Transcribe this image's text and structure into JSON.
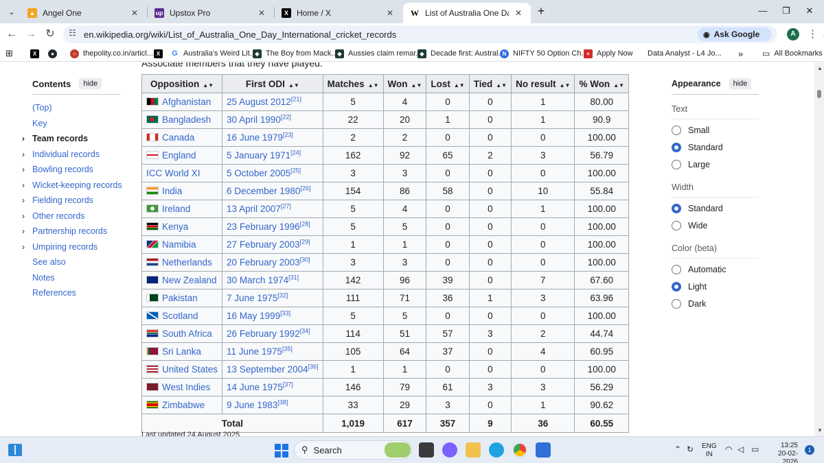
{
  "browser": {
    "tabs": [
      {
        "label": "Angel One",
        "icon": "angel-one-icon",
        "close": "✕"
      },
      {
        "label": "Upstox Pro",
        "icon": "upstox-icon",
        "close": "✕"
      },
      {
        "label": "Home / X",
        "icon": "x-icon",
        "close": "✕"
      },
      {
        "label": "List of Australia One Day Intern",
        "icon": "wikipedia-icon",
        "close": "✕"
      }
    ],
    "url": "en.wikipedia.org/wiki/List_of_Australia_One_Day_International_cricket_records",
    "ask_google": "Ask Google",
    "avatar": "A",
    "bookmarks": [
      {
        "label": "",
        "icon": "x-icon"
      },
      {
        "label": "",
        "icon": "github-icon"
      },
      {
        "label": "thepolity.co.in/articl...",
        "icon": "polity-icon"
      },
      {
        "label": "",
        "icon": "x-icon"
      },
      {
        "label": "Australia's Weird Lit...",
        "icon": "google-icon"
      },
      {
        "label": "The Boy from Mack...",
        "icon": "shield-icon"
      },
      {
        "label": "Aussies claim remar...",
        "icon": "shield-icon"
      },
      {
        "label": "Decade first: Austral...",
        "icon": "shield-icon"
      },
      {
        "label": "NIFTY 50 Option Ch...",
        "icon": "nse-icon"
      },
      {
        "label": "Apply Now",
        "icon": "apply-icon"
      },
      {
        "label": "Data Analyst - L4 Jo...",
        "icon": ""
      }
    ],
    "bookmarks_more": "»",
    "all_bookmarks": "All Bookmarks"
  },
  "page": {
    "prev_text": "Associate members that they have played."
  },
  "toc": {
    "title": "Contents",
    "hide": "hide",
    "items": [
      {
        "label": "(Top)",
        "chevron": false,
        "bold": false
      },
      {
        "label": "Key",
        "chevron": false,
        "bold": false
      },
      {
        "label": "Team records",
        "chevron": true,
        "bold": true
      },
      {
        "label": "Individual records",
        "chevron": true,
        "bold": false
      },
      {
        "label": "Bowling records",
        "chevron": true,
        "bold": false
      },
      {
        "label": "Wicket-keeping records",
        "chevron": true,
        "bold": false
      },
      {
        "label": "Fielding records",
        "chevron": true,
        "bold": false
      },
      {
        "label": "Other records",
        "chevron": true,
        "bold": false
      },
      {
        "label": "Partnership records",
        "chevron": true,
        "bold": false
      },
      {
        "label": "Umpiring records",
        "chevron": true,
        "bold": false
      },
      {
        "label": "See also",
        "chevron": false,
        "bold": false
      },
      {
        "label": "Notes",
        "chevron": false,
        "bold": false
      },
      {
        "label": "References",
        "chevron": false,
        "bold": false
      }
    ]
  },
  "table": {
    "headers": [
      "Opposition",
      "First ODI",
      "Matches",
      "Won",
      "Lost",
      "Tied",
      "No result",
      "% Won"
    ],
    "rows": [
      {
        "opp": "Afghanistan",
        "flag": "afghanistan",
        "date": "25 August 2012",
        "ref": "[21]",
        "m": "5",
        "w": "4",
        "l": "0",
        "t": "0",
        "nr": "1",
        "pct": "80.00"
      },
      {
        "opp": "Bangladesh",
        "flag": "bangladesh",
        "date": "30 April 1990",
        "ref": "[22]",
        "m": "22",
        "w": "20",
        "l": "1",
        "t": "0",
        "nr": "1",
        "pct": "90.9"
      },
      {
        "opp": "Canada",
        "flag": "canada",
        "date": "16 June 1979",
        "ref": "[23]",
        "m": "2",
        "w": "2",
        "l": "0",
        "t": "0",
        "nr": "0",
        "pct": "100.00"
      },
      {
        "opp": "England",
        "flag": "england",
        "date": "5 January 1971",
        "ref": "[24]",
        "m": "162",
        "w": "92",
        "l": "65",
        "t": "2",
        "nr": "3",
        "pct": "56.79"
      },
      {
        "opp": "ICC World XI",
        "flag": "",
        "date": "5 October 2005",
        "ref": "[25]",
        "m": "3",
        "w": "3",
        "l": "0",
        "t": "0",
        "nr": "0",
        "pct": "100.00"
      },
      {
        "opp": "India",
        "flag": "india",
        "date": "6 December 1980",
        "ref": "[26]",
        "m": "154",
        "w": "86",
        "l": "58",
        "t": "0",
        "nr": "10",
        "pct": "55.84"
      },
      {
        "opp": "Ireland",
        "flag": "ireland",
        "date": "13 April 2007",
        "ref": "[27]",
        "m": "5",
        "w": "4",
        "l": "0",
        "t": "0",
        "nr": "1",
        "pct": "100.00"
      },
      {
        "opp": "Kenya",
        "flag": "kenya",
        "date": "23 February 1996",
        "ref": "[28]",
        "m": "5",
        "w": "5",
        "l": "0",
        "t": "0",
        "nr": "0",
        "pct": "100.00"
      },
      {
        "opp": "Namibia",
        "flag": "namibia",
        "date": "27 February 2003",
        "ref": "[29]",
        "m": "1",
        "w": "1",
        "l": "0",
        "t": "0",
        "nr": "0",
        "pct": "100.00"
      },
      {
        "opp": "Netherlands",
        "flag": "netherlands",
        "date": "20 February 2003",
        "ref": "[30]",
        "m": "3",
        "w": "3",
        "l": "0",
        "t": "0",
        "nr": "0",
        "pct": "100.00"
      },
      {
        "opp": "New Zealand",
        "flag": "new-zealand",
        "date": "30 March 1974",
        "ref": "[31]",
        "m": "142",
        "w": "96",
        "l": "39",
        "t": "0",
        "nr": "7",
        "pct": "67.60"
      },
      {
        "opp": "Pakistan",
        "flag": "pakistan",
        "date": "7 June 1975",
        "ref": "[32]",
        "m": "111",
        "w": "71",
        "l": "36",
        "t": "1",
        "nr": "3",
        "pct": "63.96"
      },
      {
        "opp": "Scotland",
        "flag": "scotland",
        "date": "16 May 1999",
        "ref": "[33]",
        "m": "5",
        "w": "5",
        "l": "0",
        "t": "0",
        "nr": "0",
        "pct": "100.00"
      },
      {
        "opp": "South Africa",
        "flag": "south-africa",
        "date": "26 February 1992",
        "ref": "[34]",
        "m": "114",
        "w": "51",
        "l": "57",
        "t": "3",
        "nr": "2",
        "pct": "44.74"
      },
      {
        "opp": "Sri Lanka",
        "flag": "sri-lanka",
        "date": "11 June 1975",
        "ref": "[35]",
        "m": "105",
        "w": "64",
        "l": "37",
        "t": "0",
        "nr": "4",
        "pct": "60.95"
      },
      {
        "opp": "United States",
        "flag": "united-states",
        "date": "13 September 2004",
        "ref": "[36]",
        "m": "1",
        "w": "1",
        "l": "0",
        "t": "0",
        "nr": "0",
        "pct": "100.00"
      },
      {
        "opp": "West Indies",
        "flag": "west-indies",
        "date": "14 June 1975",
        "ref": "[37]",
        "m": "146",
        "w": "79",
        "l": "61",
        "t": "3",
        "nr": "3",
        "pct": "56.29"
      },
      {
        "opp": "Zimbabwe",
        "flag": "zimbabwe",
        "date": "9 June 1983",
        "ref": "[38]",
        "m": "33",
        "w": "29",
        "l": "3",
        "t": "0",
        "nr": "1",
        "pct": "90.62"
      }
    ],
    "total": {
      "label": "Total",
      "m": "1,019",
      "w": "617",
      "l": "357",
      "t": "9",
      "nr": "36",
      "pct": "60.55"
    },
    "note": "Last updated 24 August 2025"
  },
  "appearance": {
    "title": "Appearance",
    "hide": "hide",
    "groups": [
      {
        "label": "Text",
        "options": [
          {
            "label": "Small",
            "selected": false
          },
          {
            "label": "Standard",
            "selected": true
          },
          {
            "label": "Large",
            "selected": false
          }
        ]
      },
      {
        "label": "Width",
        "options": [
          {
            "label": "Standard",
            "selected": true
          },
          {
            "label": "Wide",
            "selected": false
          }
        ]
      },
      {
        "label": "Color (beta)",
        "options": [
          {
            "label": "Automatic",
            "selected": false
          },
          {
            "label": "Light",
            "selected": true
          },
          {
            "label": "Dark",
            "selected": false
          }
        ]
      }
    ]
  },
  "taskbar": {
    "search": "Search",
    "lang": "ENG",
    "region": "IN",
    "time": "13:25",
    "date": "20-02-2026",
    "notifications": "1"
  },
  "colors": {
    "link": "#3366cc",
    "accent": "#3366cc",
    "tab_strip": "#dde3ea",
    "omnibox": "#edf2fa"
  }
}
